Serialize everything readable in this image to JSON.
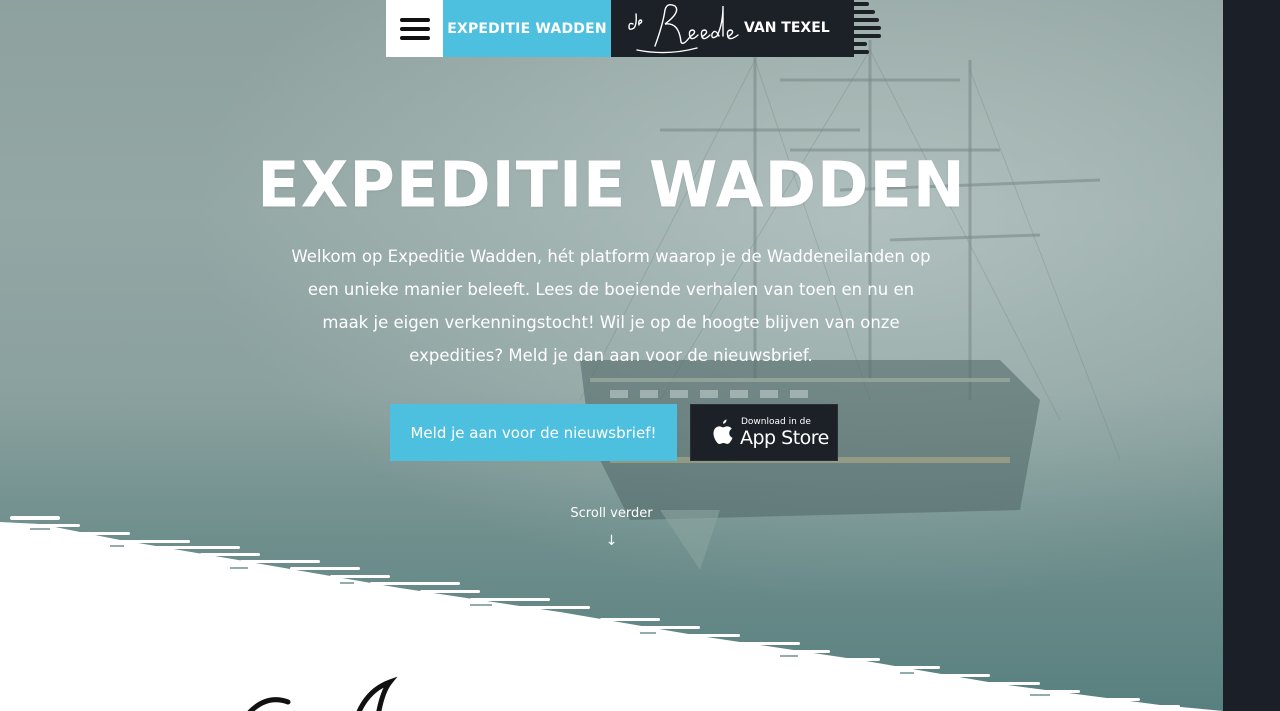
{
  "nav": {
    "menu_icon": "hamburger-icon",
    "tab_wadden": "EXPEDITIE WADDEN",
    "tab_reede_script": "de Reede",
    "tab_reede_suffix": "VAN TEXEL"
  },
  "hero": {
    "title": "EXPEDITIE WADDEN",
    "intro": "Welkom op Expeditie Wadden, hét platform waarop je de Waddeneilanden op een unieke manier beleeft. Lees de boeiende verhalen van toen en nu en maak je eigen verkenningstocht! Wil je op de hoogte blijven van onze expedities? Meld je dan aan voor de nieuwsbrief.",
    "newsletter_button": "Meld je aan voor de nieuwsbrief!",
    "appstore_small": "Download in de",
    "appstore_big": "App Store",
    "appstore_icon": "apple-icon",
    "scroll_label": "Scroll verder",
    "scroll_arrow": "↓"
  },
  "colors": {
    "accent": "#4ec0df",
    "dark": "#1c2027",
    "white": "#ffffff"
  }
}
